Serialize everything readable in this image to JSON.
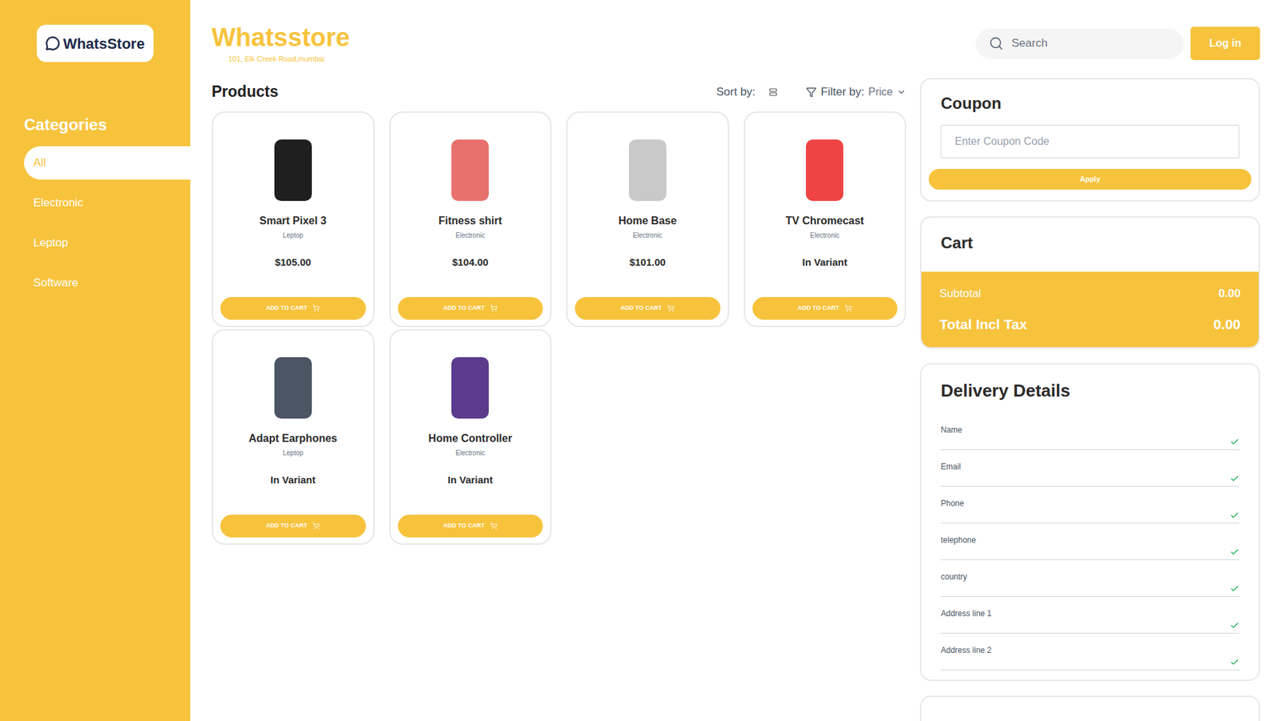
{
  "logo": {
    "text": "WhatsStore"
  },
  "sidebar": {
    "heading": "Categories",
    "items": [
      {
        "label": "All",
        "selected": true
      },
      {
        "label": "Electronic",
        "selected": false
      },
      {
        "label": "Leptop",
        "selected": false
      },
      {
        "label": "Software",
        "selected": false
      }
    ]
  },
  "header": {
    "title": "Whatsstore",
    "address": "101, Elk Creek Road,mumbai",
    "search_placeholder": "Search",
    "login": "Log in"
  },
  "products_section": {
    "heading": "Products",
    "sort_label": "Sort by:",
    "filter_label": "Filter by:",
    "filter_value": "Price"
  },
  "products": [
    {
      "name": "Smart Pixel 3",
      "category": "Leptop",
      "price": "$105.00",
      "button": "ADD TO CART",
      "color": "#1f1f1f"
    },
    {
      "name": "Fitness shirt",
      "category": "Electronic",
      "price": "$104.00",
      "button": "ADD TO CART",
      "color": "#e8716d"
    },
    {
      "name": "Home Base",
      "category": "Electronic",
      "price": "$101.00",
      "button": "ADD TO CART",
      "color": "#c9c9c9"
    },
    {
      "name": "TV Chromecast",
      "category": "Electronic",
      "price": "In Variant",
      "button": "ADD TO CART",
      "color": "#ef4444"
    },
    {
      "name": "Adapt Earphones",
      "category": "Leptop",
      "price": "In Variant",
      "button": "ADD TO CART",
      "color": "#4b5563"
    },
    {
      "name": "Home Controller",
      "category": "Electronic",
      "price": "In Variant",
      "button": "ADD TO CART",
      "color": "#5b3c8c"
    }
  ],
  "coupon": {
    "title": "Coupon",
    "placeholder": "Enter Coupon Code",
    "button": "Apply"
  },
  "cart": {
    "title": "Cart",
    "subtotal_label": "Subtotal",
    "subtotal_value": "0.00",
    "total_label": "Total Incl Tax",
    "total_value": "0.00"
  },
  "delivery": {
    "title": "Delivery Details",
    "fields": [
      {
        "label": "Name",
        "checked": true
      },
      {
        "label": "Email",
        "checked": true
      },
      {
        "label": "Phone",
        "checked": true
      },
      {
        "label": "telephone",
        "checked": true
      },
      {
        "label": "country",
        "checked": true
      },
      {
        "label": "Address line 1",
        "checked": true
      },
      {
        "label": "Address line 2",
        "checked": true
      }
    ]
  }
}
